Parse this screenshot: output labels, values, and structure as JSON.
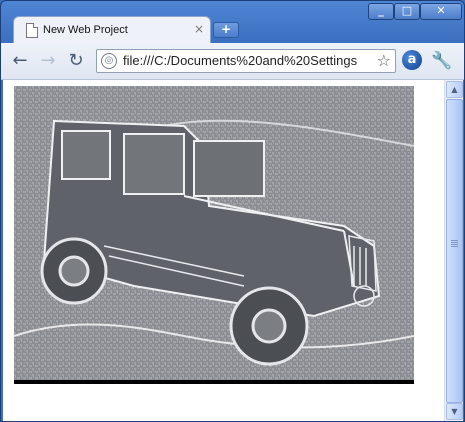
{
  "window": {
    "controls": {
      "minimize": "_",
      "maximize": "□",
      "close": "✕"
    }
  },
  "tab": {
    "title": "New Web Project",
    "close_glyph": "×",
    "icon": "page-icon"
  },
  "new_tab": {
    "glyph": "+"
  },
  "toolbar": {
    "back_glyph": "←",
    "forward_glyph": "→",
    "reload_glyph": "↻",
    "url": "file:///C:/Documents%20and%20Settings",
    "bookmark_glyph": "☆",
    "extension_glyph": "a",
    "wrench_glyph": "🔧"
  },
  "content": {
    "image_subject": "jeep-photo"
  },
  "scrollbar": {
    "up_glyph": "▲",
    "down_glyph": "▼"
  },
  "colors": {
    "frame": "#3d6fb8",
    "toolbar": "#e6ecf5",
    "photo": "#8d9095"
  }
}
